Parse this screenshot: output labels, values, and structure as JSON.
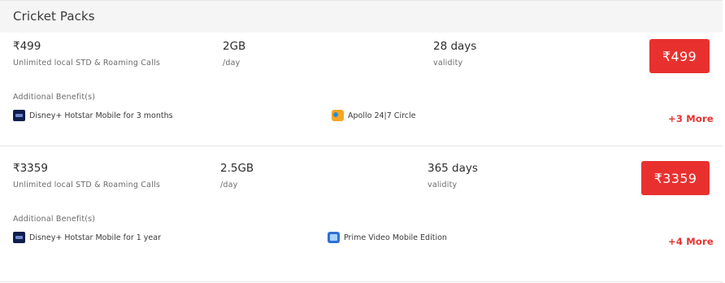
{
  "section": {
    "title": "Cricket Packs"
  },
  "plans": [
    {
      "price": "₹499",
      "calls": "Unlimited local STD & Roaming Calls",
      "data": "2GB",
      "data_unit": "/day",
      "validity": "28 days",
      "validity_label": "validity",
      "button_label": "₹499",
      "benefits_title": "Additional Benefit(s)",
      "benefits": [
        {
          "label": "Disney+ Hotstar Mobile for 3 months",
          "icon": "hotstar-icon"
        },
        {
          "label": "Apollo 24|7 Circle",
          "icon": "apollo-icon"
        }
      ],
      "more": "+3 More"
    },
    {
      "price": "₹3359",
      "calls": "Unlimited local STD & Roaming Calls",
      "data": "2.5GB",
      "data_unit": "/day",
      "validity": "365 days",
      "validity_label": "validity",
      "button_label": "₹3359",
      "benefits_title": "Additional Benefit(s)",
      "benefits": [
        {
          "label": "Disney+ Hotstar Mobile for 1 year",
          "icon": "hotstar-icon"
        },
        {
          "label": "Prime Video Mobile Edition",
          "icon": "prime-video-icon"
        }
      ],
      "more": "+4 More"
    }
  ],
  "colors": {
    "accent": "#e8312f",
    "header_bg": "#f5f5f5"
  }
}
